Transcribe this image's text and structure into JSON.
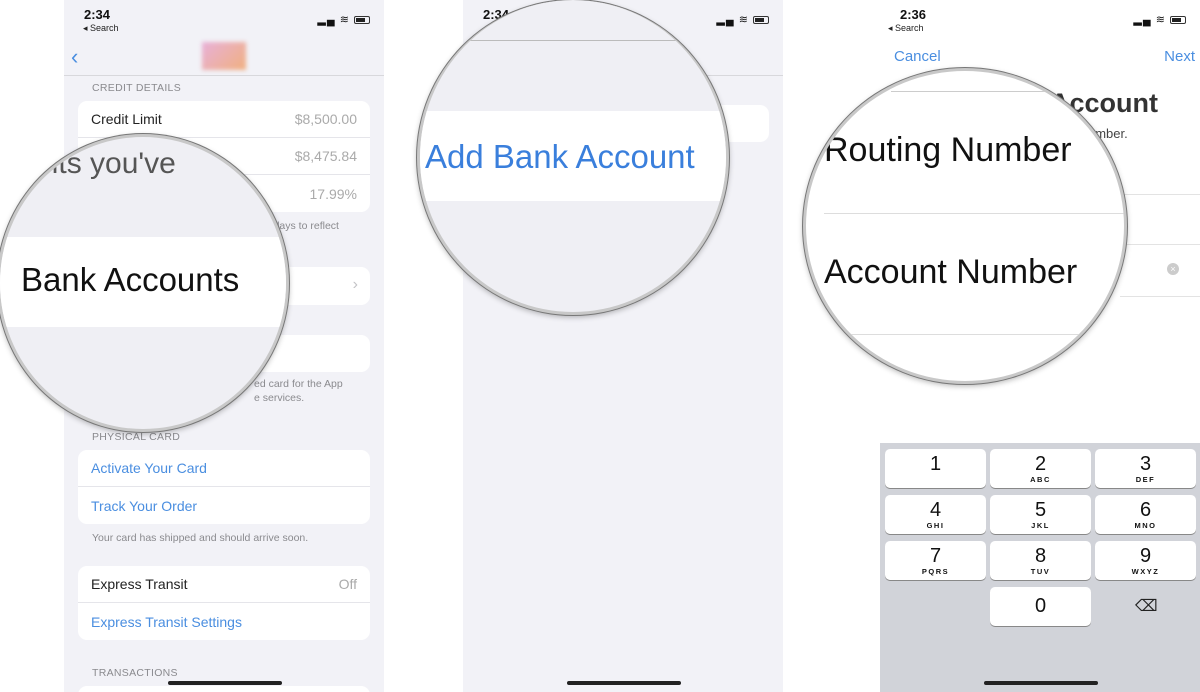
{
  "panel1": {
    "status": {
      "time": "2:34",
      "back": "◂ Search"
    },
    "credit_details": {
      "header": "CREDIT DETAILS",
      "rows": [
        {
          "label": "Credit Limit",
          "value": "$8,500.00"
        },
        {
          "label": "",
          "value": "$8,475.84"
        },
        {
          "label": "",
          "value": "17.99%"
        }
      ],
      "footer_fragment": "ral days to reflect"
    },
    "magnifier": {
      "top_text": "ments you've",
      "label": "Bank Accounts"
    },
    "app_footer_fragment": [
      "ed card for the App",
      "e services."
    ],
    "physical_card": {
      "header": "PHYSICAL CARD",
      "rows": [
        "Activate Your Card",
        "Track Your Order"
      ],
      "footer": "Your card has shipped and should arrive soon."
    },
    "express": {
      "label": "Express Transit",
      "value": "Off",
      "settings": "Express Transit Settings"
    },
    "transactions_header": "TRANSACTIONS"
  },
  "panel2": {
    "status": {
      "time": "2:34"
    },
    "magnifier": {
      "label": "Add Bank Account"
    }
  },
  "panel3": {
    "status": {
      "time": "2:36",
      "back": "◂ Search"
    },
    "nav": {
      "cancel": "Cancel",
      "next": "Next"
    },
    "title_fragment": "Account",
    "subtitle_fragment": "umber.",
    "magnifier": {
      "routing": "Routing Number",
      "account": "Account Number"
    },
    "keypad": [
      {
        "n": "1",
        "l": ""
      },
      {
        "n": "2",
        "l": "ABC"
      },
      {
        "n": "3",
        "l": "DEF"
      },
      {
        "n": "4",
        "l": "GHI"
      },
      {
        "n": "5",
        "l": "JKL"
      },
      {
        "n": "6",
        "l": "MNO"
      },
      {
        "n": "7",
        "l": "PQRS"
      },
      {
        "n": "8",
        "l": "TUV"
      },
      {
        "n": "9",
        "l": "WXYZ"
      },
      {
        "n": "0",
        "l": ""
      }
    ]
  },
  "colors": {
    "accent": "#4a8ee0",
    "background": "#f2f2f7"
  }
}
